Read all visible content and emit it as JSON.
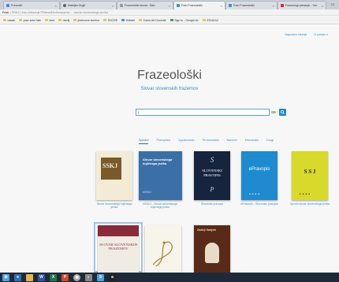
{
  "browser": {
    "tabs": [
      {
        "label": "Prevoditi",
        "color": "#4285f4"
      },
      {
        "label": "Matejka Grgič",
        "color": "#5f6368"
      },
      {
        "label": "Frazeološki slovar - Ban",
        "color": "#888888"
      },
      {
        "label": "Fran Frazeološki",
        "color": "#3a8fc8"
      },
      {
        "label": "Fran Frazeološki",
        "color": "#3a8fc8"
      },
      {
        "label": "Frazeologi plesanje - You",
        "color": "#e62117"
      }
    ],
    "url_host": "Fran",
    "url_path": "| SSKJ | fran.si/iskanje?FilteredDictionaryIds=... slovar slovenskega jezika",
    "bookmarks": [
      "nasak",
      "prav soim late",
      "ekst",
      "medij",
      "jezikovne storitve",
      "SSCRE",
      "Wikiste",
      "Carta del Docente",
      "Sign in - Google Ac",
      "EDUKA2"
    ]
  },
  "page": {
    "top_links": [
      "Napredno iskanje",
      "O portalu ▾"
    ],
    "title": "Frazeološki",
    "subtitle": "Slovar slovenskih frazemov",
    "search_value": "|",
    "search_placeholder": "",
    "tabs": [
      "Splošni",
      "Pravopisni",
      "Zgodovinski",
      "Terminološki",
      "Narečni",
      "Etimološki",
      "Drugi"
    ],
    "books_row1": [
      {
        "caption": "Slovar slovenskega knjižnega jezika"
      },
      {
        "caption": "eSSKJ – Slovar slovenskega knjižnega jezika"
      },
      {
        "caption": "Slovenski pravopis"
      },
      {
        "caption": "ePravopis – Slovenski pravopis"
      },
      {
        "caption": "Sprotni slovar slovenskega jezika"
      }
    ],
    "book_covers": {
      "sskj_short": "SSKJ",
      "esskj_title": "Slovar slovenskega knjižnega jezika",
      "esskj_brand": "eSSKJ",
      "sp_letter": "S",
      "sp_title": "SLOVENSKI PRAVOPIS",
      "sp_letter2": "P",
      "epravopis": "ePravopis",
      "sprotni": "S S J",
      "sssf_title": "SLOVAR SLOVENSKIH FRAZEMOV",
      "zadnji_title": "Zadnji Sanjski"
    }
  },
  "colors": {
    "accent": "#1e8bd1",
    "link": "#3a8fc8"
  }
}
